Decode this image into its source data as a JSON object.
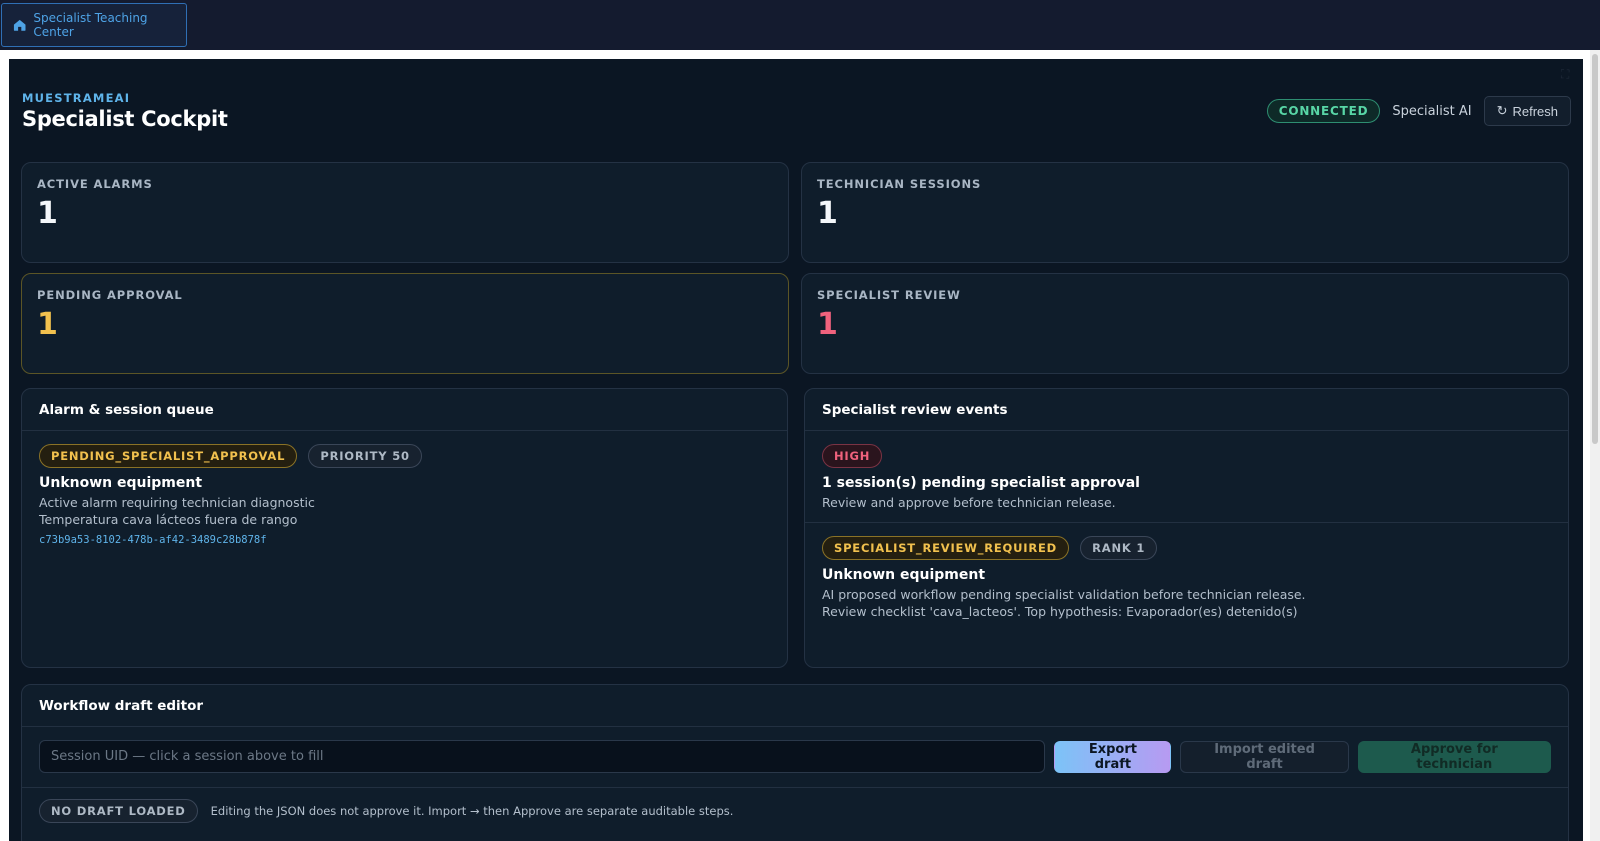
{
  "topbar": {
    "home_label": "Specialist Teaching Center"
  },
  "header": {
    "kicker": "MUESTRAMEAI",
    "title": "Specialist Cockpit",
    "status": "CONNECTED",
    "role": "Specialist AI",
    "refresh_label": "Refresh"
  },
  "stats": [
    {
      "label": "ACTIVE ALARMS",
      "value": "1"
    },
    {
      "label": "TECHNICIAN SESSIONS",
      "value": "1"
    },
    {
      "label": "PENDING APPROVAL",
      "value": "1"
    },
    {
      "label": "SPECIALIST REVIEW",
      "value": "1"
    }
  ],
  "queue": {
    "title": "Alarm & session queue",
    "items": [
      {
        "status": "PENDING_SPECIALIST_APPROVAL",
        "priority": "PRIORITY 50",
        "title": "Unknown equipment",
        "line1": "Active alarm requiring technician diagnostic",
        "line2": "Temperatura cava lácteos fuera de rango",
        "uid": "c73b9a53-8102-478b-af42-3489c28b878f"
      }
    ]
  },
  "review": {
    "title": "Specialist review events",
    "events": [
      {
        "severity": "HIGH",
        "title": "1 session(s) pending specialist approval",
        "line1": "Review and approve before technician release."
      },
      {
        "tag": "SPECIALIST_REVIEW_REQUIRED",
        "rank": "RANK 1",
        "title": "Unknown equipment",
        "line1": "AI proposed workflow pending specialist validation before technician release.",
        "line2": "Review checklist 'cava_lacteos'. Top hypothesis: Evaporador(es) detenido(s)"
      }
    ]
  },
  "editor": {
    "title": "Workflow draft editor",
    "uid_placeholder": "Session UID — click a session above to fill",
    "export_label": "Export draft",
    "import_label": "Import edited draft",
    "approve_label": "Approve for technician",
    "draft_status": "NO DRAFT LOADED",
    "note": "Editing the JSON does not approve it. Import → then Approve are separate auditable steps."
  },
  "colors": {
    "accent": "#5fb4ea",
    "connected": "#58d6a6",
    "pending": "#f2c14e",
    "review": "#f0627d",
    "background": "#0b1623"
  },
  "icons": {
    "home": "home-icon",
    "refresh": "refresh-icon",
    "expand": "expand-icon"
  }
}
